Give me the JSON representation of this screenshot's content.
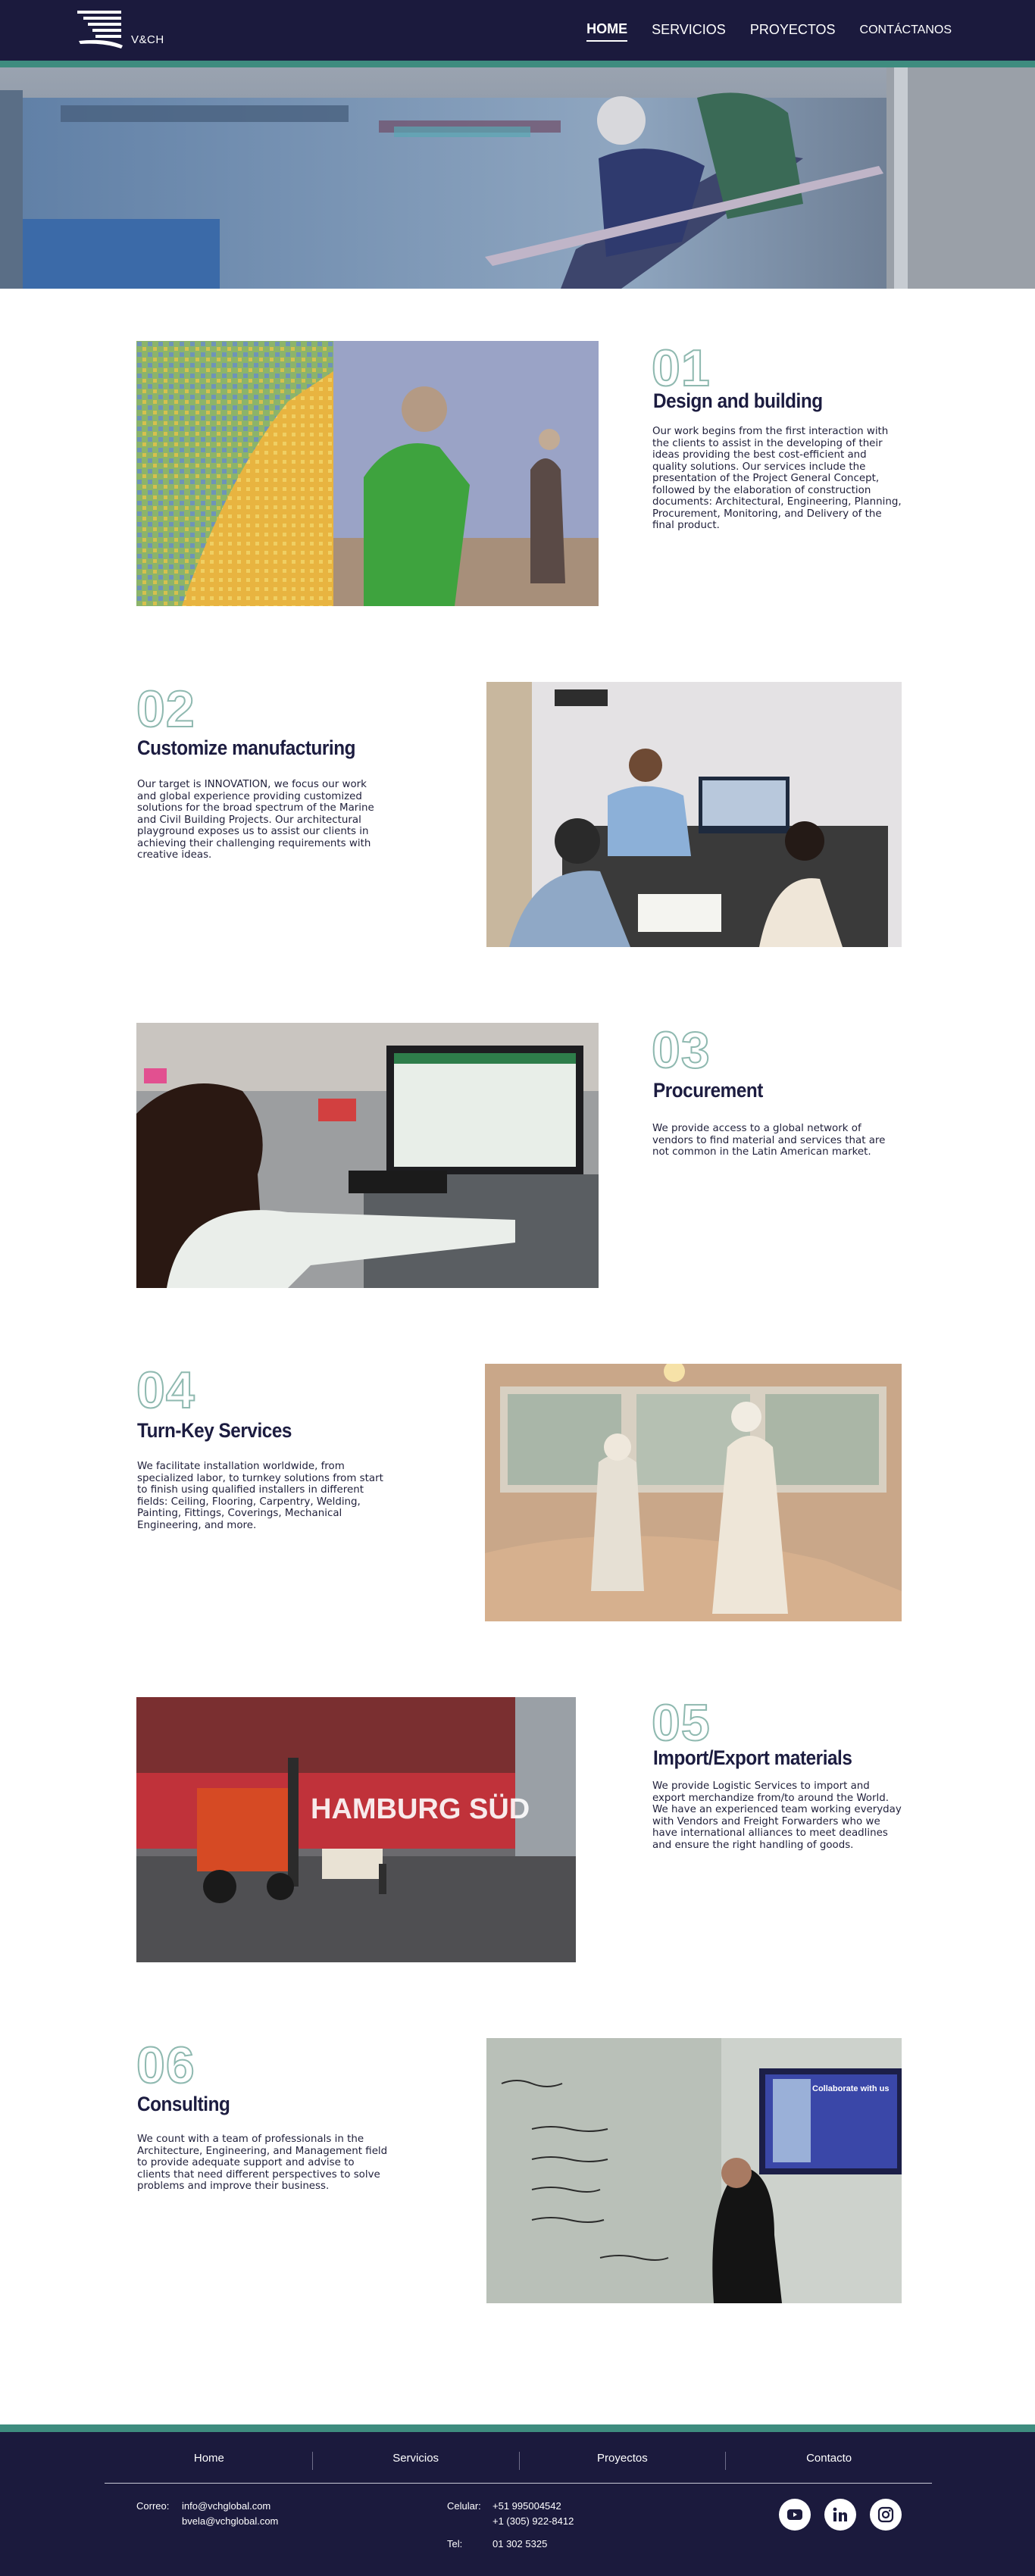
{
  "header": {
    "logo_text": "V&CH",
    "nav": [
      {
        "label": "HOME",
        "active": true
      },
      {
        "label": "SERVICIOS",
        "active": false
      },
      {
        "label": "PROYECTOS",
        "active": false
      },
      {
        "label": "CONTÁCTANOS",
        "active": false
      }
    ]
  },
  "sections": [
    {
      "number": "01",
      "title": "Design and building",
      "body": "Our work begins from the first interaction with the clients to assist in the developing of their ideas providing the best cost-efficient and quality solutions. Our services include the presentation of the Project General Concept, followed by the elaboration of construction documents: Architectural, Engineering, Planning, Procurement, Monitoring, and Delivery of the final product."
    },
    {
      "number": "02",
      "title": "Customize manufacturing",
      "body": "Our target is INNOVATION, we focus our work and global experience providing customized solutions for the broad spectrum of the Marine and Civil Building Projects. Our architectural playground exposes us to assist our clients in achieving their challenging requirements with creative ideas."
    },
    {
      "number": "03",
      "title": "Procurement",
      "body": "We provide access to a global network of vendors to find material and services that are not common in the Latin American market."
    },
    {
      "number": "04",
      "title": "Turn-Key Services",
      "body": "We facilitate installation worldwide, from specialized labor, to turnkey solutions from start to finish using qualified installers in different fields: Ceiling, Flooring, Carpentry, Welding, Painting, Fittings, Coverings, Mechanical Engineering, and more."
    },
    {
      "number": "05",
      "title": "Import/Export materials",
      "body": "We provide Logistic Services to import and export merchandize from/to around the World. We have an experienced team working everyday with Vendors and Freight Forwarders who we have international alliances to meet deadlines and ensure the right handling of goods."
    },
    {
      "number": "06",
      "title": "Consulting",
      "body": "We count with a team of professionals in the Architecture, Engineering, and Management field to provide adequate support and advise to clients that need different perspectives to solve problems and improve their business."
    }
  ],
  "images": {
    "container_text": "HAMBURG SÜD",
    "whiteboard_title": "Collaborate with us"
  },
  "footer": {
    "nav": [
      "Home",
      "Servicios",
      "Proyectos",
      "Contacto"
    ],
    "correo_label": "Correo:",
    "emails": [
      "info@vchglobal.com",
      "bvela@vchglobal.com"
    ],
    "celular_label": "Celular:",
    "phones": [
      "+51 995004542",
      "+1 (305) 922-8412"
    ],
    "tel_label": "Tel:",
    "tel": "01 302 5325",
    "social": [
      "youtube-icon",
      "linkedin-icon",
      "instagram-icon"
    ]
  },
  "colors": {
    "navy": "#1b1a3d",
    "teal": "#3e8c7f",
    "outline_number": "#8fb9b0"
  }
}
